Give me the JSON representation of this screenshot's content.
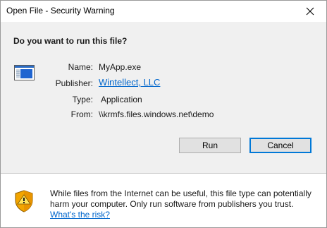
{
  "window": {
    "title": "Open File - Security Warning"
  },
  "dialog": {
    "question": "Do you want to run this file?",
    "fields": {
      "name_label": "Name:",
      "name_value": "MyApp.exe",
      "publisher_label": "Publisher:",
      "publisher_value": "Wintellect, LLC",
      "type_label": "Type:",
      "type_value": "Application",
      "from_label": "From:",
      "from_value": "\\\\krmfs.files.windows.net\\demo"
    },
    "buttons": {
      "run": "Run",
      "cancel": "Cancel"
    }
  },
  "footer": {
    "warning_line1": "While files from the Internet can be useful, this file type can potentially",
    "warning_line2": "harm your computer. Only run software from publishers you trust.",
    "risk_link": "What's the risk?"
  },
  "icons": {
    "close": "close-icon",
    "file": "application-file-icon",
    "shield": "warning-shield-icon"
  }
}
